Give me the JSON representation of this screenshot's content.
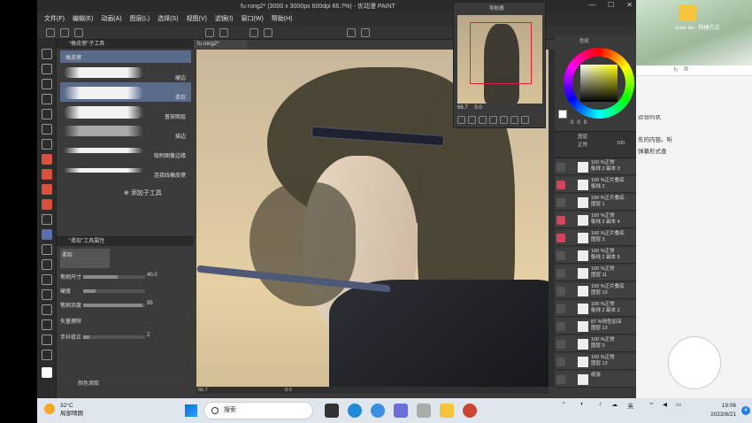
{
  "window": {
    "title": "fu rong2* (3000 x 3000px 600dpi 66.7%) - 优动漫 PAINT",
    "controls": [
      "—",
      "☐",
      "✕"
    ]
  },
  "menu": [
    "文件(F)",
    "编辑(E)",
    "动画(A)",
    "图层(L)",
    "选择(S)",
    "视图(V)",
    "滤镜(I)",
    "窗口(W)",
    "帮助(H)"
  ],
  "subtool": {
    "header": "\"橡皮擦\"子工具",
    "selected": "橡皮擦",
    "items": [
      {
        "label": "硬边"
      },
      {
        "label": "柔软"
      },
      {
        "label": "普穿图层"
      },
      {
        "label": "描边"
      },
      {
        "label": "吸附图像边缘"
      },
      {
        "label": "连接线橡皮擦"
      }
    ],
    "add_label": "添加子工具"
  },
  "properties": {
    "header": "\"柔软\"工具属性",
    "name": "柔软",
    "rows": [
      {
        "label": "笔刷尺寸",
        "value": "40.0",
        "level": 0.55
      },
      {
        "label": "硬度",
        "value": "",
        "level": 0.2
      },
      {
        "label": "笔刷浓度",
        "value": "95",
        "level": 0.95
      },
      {
        "label": "矢量擦除",
        "value": "",
        "level": 0
      },
      {
        "label": "手抖修正",
        "value": "2",
        "level": 0.1
      }
    ],
    "footer": "颜色滴取"
  },
  "canvas": {
    "tab": "fu rong2*",
    "zoom": "66.7",
    "angle": "0.0"
  },
  "navigator": {
    "title": "导航器",
    "zoom": "66.7",
    "angle": "0.0"
  },
  "color": {
    "header": "色轮",
    "hsv": [
      "0",
      "0",
      "0"
    ]
  },
  "layers": {
    "header": "图层",
    "blend": "正常",
    "opacity": "100",
    "rows": [
      {
        "text1": "100 %正常",
        "text2": "衡线 2 副本 3",
        "visible": true
      },
      {
        "text1": "100 %正片叠底",
        "text2": "衡线 2",
        "visible": true
      },
      {
        "text1": "100 %正片叠底",
        "text2": "图层 1",
        "visible": true
      },
      {
        "text1": "100 %正常",
        "text2": "衡线 2 副本 4",
        "visible": true
      },
      {
        "text1": "100 %正片叠底",
        "text2": "图层 3",
        "visible": true
      },
      {
        "text1": "100 %正常",
        "text2": "衡线 2 副本 5",
        "visible": false
      },
      {
        "text1": "100 %正常",
        "text2": "图层 11",
        "visible": false
      },
      {
        "text1": "100 %正片叠底",
        "text2": "图层 10",
        "visible": false
      },
      {
        "text1": "100 %正常",
        "text2": "衡线 2 副本 2",
        "visible": false
      },
      {
        "text1": "87 %线性加深",
        "text2": "图层 13",
        "visible": false
      },
      {
        "text1": "100 %正常",
        "text2": "图层 9",
        "visible": false
      },
      {
        "text1": "100 %正常",
        "text2": "图层 12",
        "visible": false
      },
      {
        "text1": "",
        "text2": "纸张",
        "visible": false
      }
    ]
  },
  "side": {
    "desktop_label": "xuex ao - 快捷方式",
    "text_lines": [
      "适合的状",
      "",
      "东的内容。听",
      "弹幕形式查"
    ],
    "red_lines": [
      "",
      "",
      "",
      ""
    ]
  },
  "taskbar": {
    "weather_temp": "32°C",
    "weather_desc": "局部晴朗",
    "search_label": "搜索",
    "ime": "英",
    "time": "19:06",
    "date": "2023/8/21",
    "notif_count": "4"
  }
}
